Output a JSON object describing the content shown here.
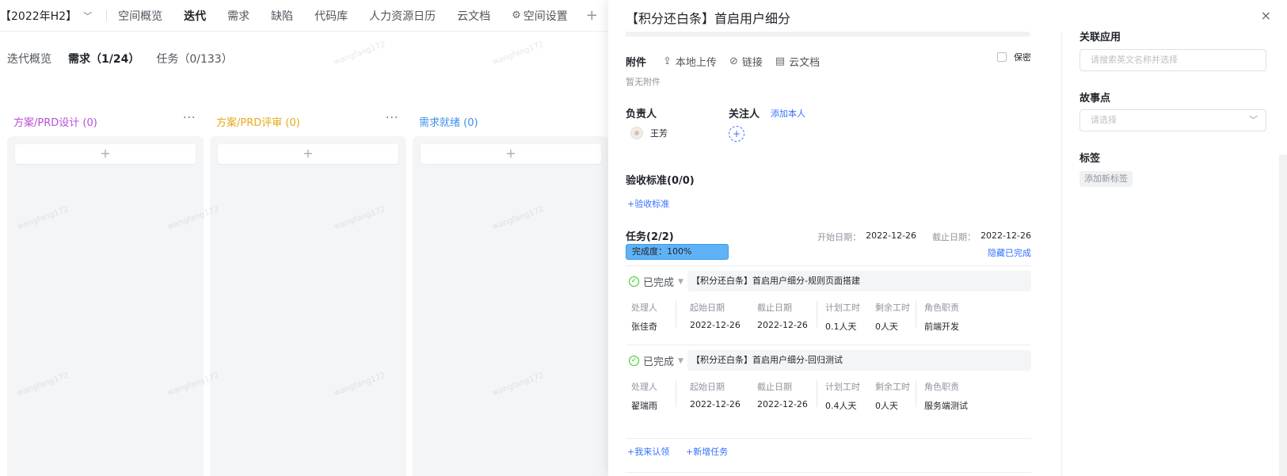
{
  "topnav": {
    "iteration": "【2022年H2】",
    "items": [
      "空间概览",
      "迭代",
      "需求",
      "缺陷",
      "代码库",
      "人力资源日历",
      "云文档",
      "空间设置"
    ]
  },
  "subtabs": [
    "迭代概览",
    "需求（1/24）",
    "任务（0/133）"
  ],
  "columns": [
    {
      "title": "方案/PRD设计 (0)",
      "color": "#b84fd6",
      "more": "···"
    },
    {
      "title": "方案/PRD评审 (0)",
      "color": "#e6a817",
      "more": "···"
    },
    {
      "title": "需求就绪 (0)",
      "color": "#3b8fe8"
    }
  ],
  "add_symbol": "+",
  "watermark": "wangfang172",
  "drawer": {
    "title": "【积分还白条】首启用户细分",
    "close": "×",
    "attachments": {
      "label": "附件",
      "upload": "本地上传",
      "link": "链接",
      "cloud_doc": "云文档",
      "confidential": "保密",
      "empty": "暂无附件"
    },
    "owner": {
      "label": "负责人",
      "name": "王芳"
    },
    "followers": {
      "label": "关注人",
      "add_self": "添加本人",
      "add": "+"
    },
    "acceptance": {
      "title": "验收标准(0/0)",
      "add": "+验收标准"
    },
    "tasks": {
      "title": "任务(2/2)",
      "start_label": "开始日期：",
      "start": "2022-12-26",
      "end_label": "截止日期：",
      "end": "2022-12-26",
      "progress_label": "完成度：",
      "progress": "100%",
      "progress_value": 1.0,
      "hide_completed": "隐藏已完成",
      "headers": [
        "处理人",
        "起始日期",
        "截止日期",
        "计划工时",
        "剩余工时",
        "角色职责"
      ],
      "items": [
        {
          "status": "已完成",
          "name": "【积分还白条】首启用户细分-规则页面搭建",
          "values": [
            "张佳奇",
            "2022-12-26",
            "2022-12-26",
            "0.1人天",
            "0人天",
            "前端开发"
          ]
        },
        {
          "status": "已完成",
          "name": "【积分还白条】首启用户细分-回归测试",
          "values": [
            "翟瑞雨",
            "2022-12-26",
            "2022-12-26",
            "0.4人天",
            "0人天",
            "服务端测试"
          ]
        }
      ],
      "claim": "+我来认领",
      "add_task": "+新增任务"
    },
    "side": {
      "related_app": "关联应用",
      "related_placeholder": "请搜索英文名称并选择",
      "story_points": "故事点",
      "story_placeholder": "请选择",
      "tags": "标签",
      "add_tag": "添加新标签"
    }
  }
}
